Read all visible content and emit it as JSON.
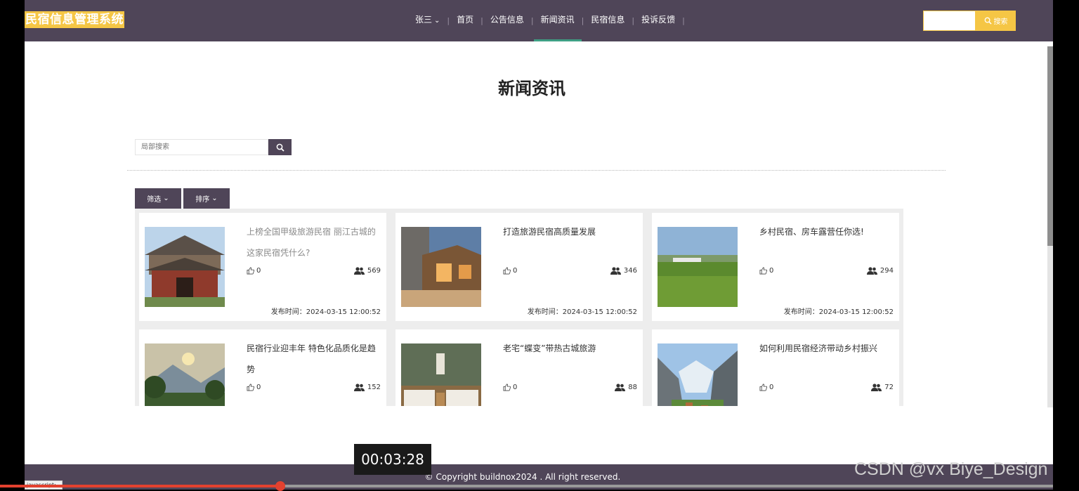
{
  "header": {
    "logo": "民宿信息管理系统",
    "user_menu": "张三",
    "nav": [
      "首页",
      "公告信息",
      "新闻资讯",
      "民宿信息",
      "投诉反馈"
    ],
    "active_nav": "新闻资讯",
    "search_button": "搜索",
    "accent_color": "#f5c645",
    "bar_color": "#4f4558"
  },
  "page": {
    "title": "新闻资讯",
    "local_search_placeholder": "局部搜索",
    "filter_label": "筛选",
    "sort_label": "排序"
  },
  "cards": [
    {
      "title": "上榜全国甲级旅游民宿 丽江古城的这家民宿凭什么?",
      "likes": "0",
      "views": "569",
      "date": "发布时间：2024-03-15 12:00:52",
      "image": "traditional-courtyard-inn"
    },
    {
      "title": "打造旅游民宿高质量发展",
      "likes": "0",
      "views": "346",
      "date": "发布时间：2024-03-15 12:00:52",
      "image": "stone-cabin-dusk"
    },
    {
      "title": "乡村民宿、房车露营任你选!",
      "likes": "0",
      "views": "294",
      "date": "发布时间：2024-03-15 12:00:52",
      "image": "rice-field"
    },
    {
      "title": "民宿行业迎丰年 特色化品质化是趋势",
      "likes": "0",
      "views": "152",
      "image": "mountain-garden"
    },
    {
      "title": "老宅“蝶变”带热古城旅游",
      "likes": "0",
      "views": "88",
      "image": "guest-bedroom"
    },
    {
      "title": "如何利用民宿经济带动乡村振兴",
      "likes": "0",
      "views": "72",
      "image": "alpine-valley"
    }
  ],
  "footer": {
    "copyright": "© Copyright buildnox2024 . All right reserved."
  },
  "overlay": {
    "timer": "00:03:28",
    "watermark": "CSDN @vx  Biye_Design",
    "status_chip": "javascript:"
  }
}
